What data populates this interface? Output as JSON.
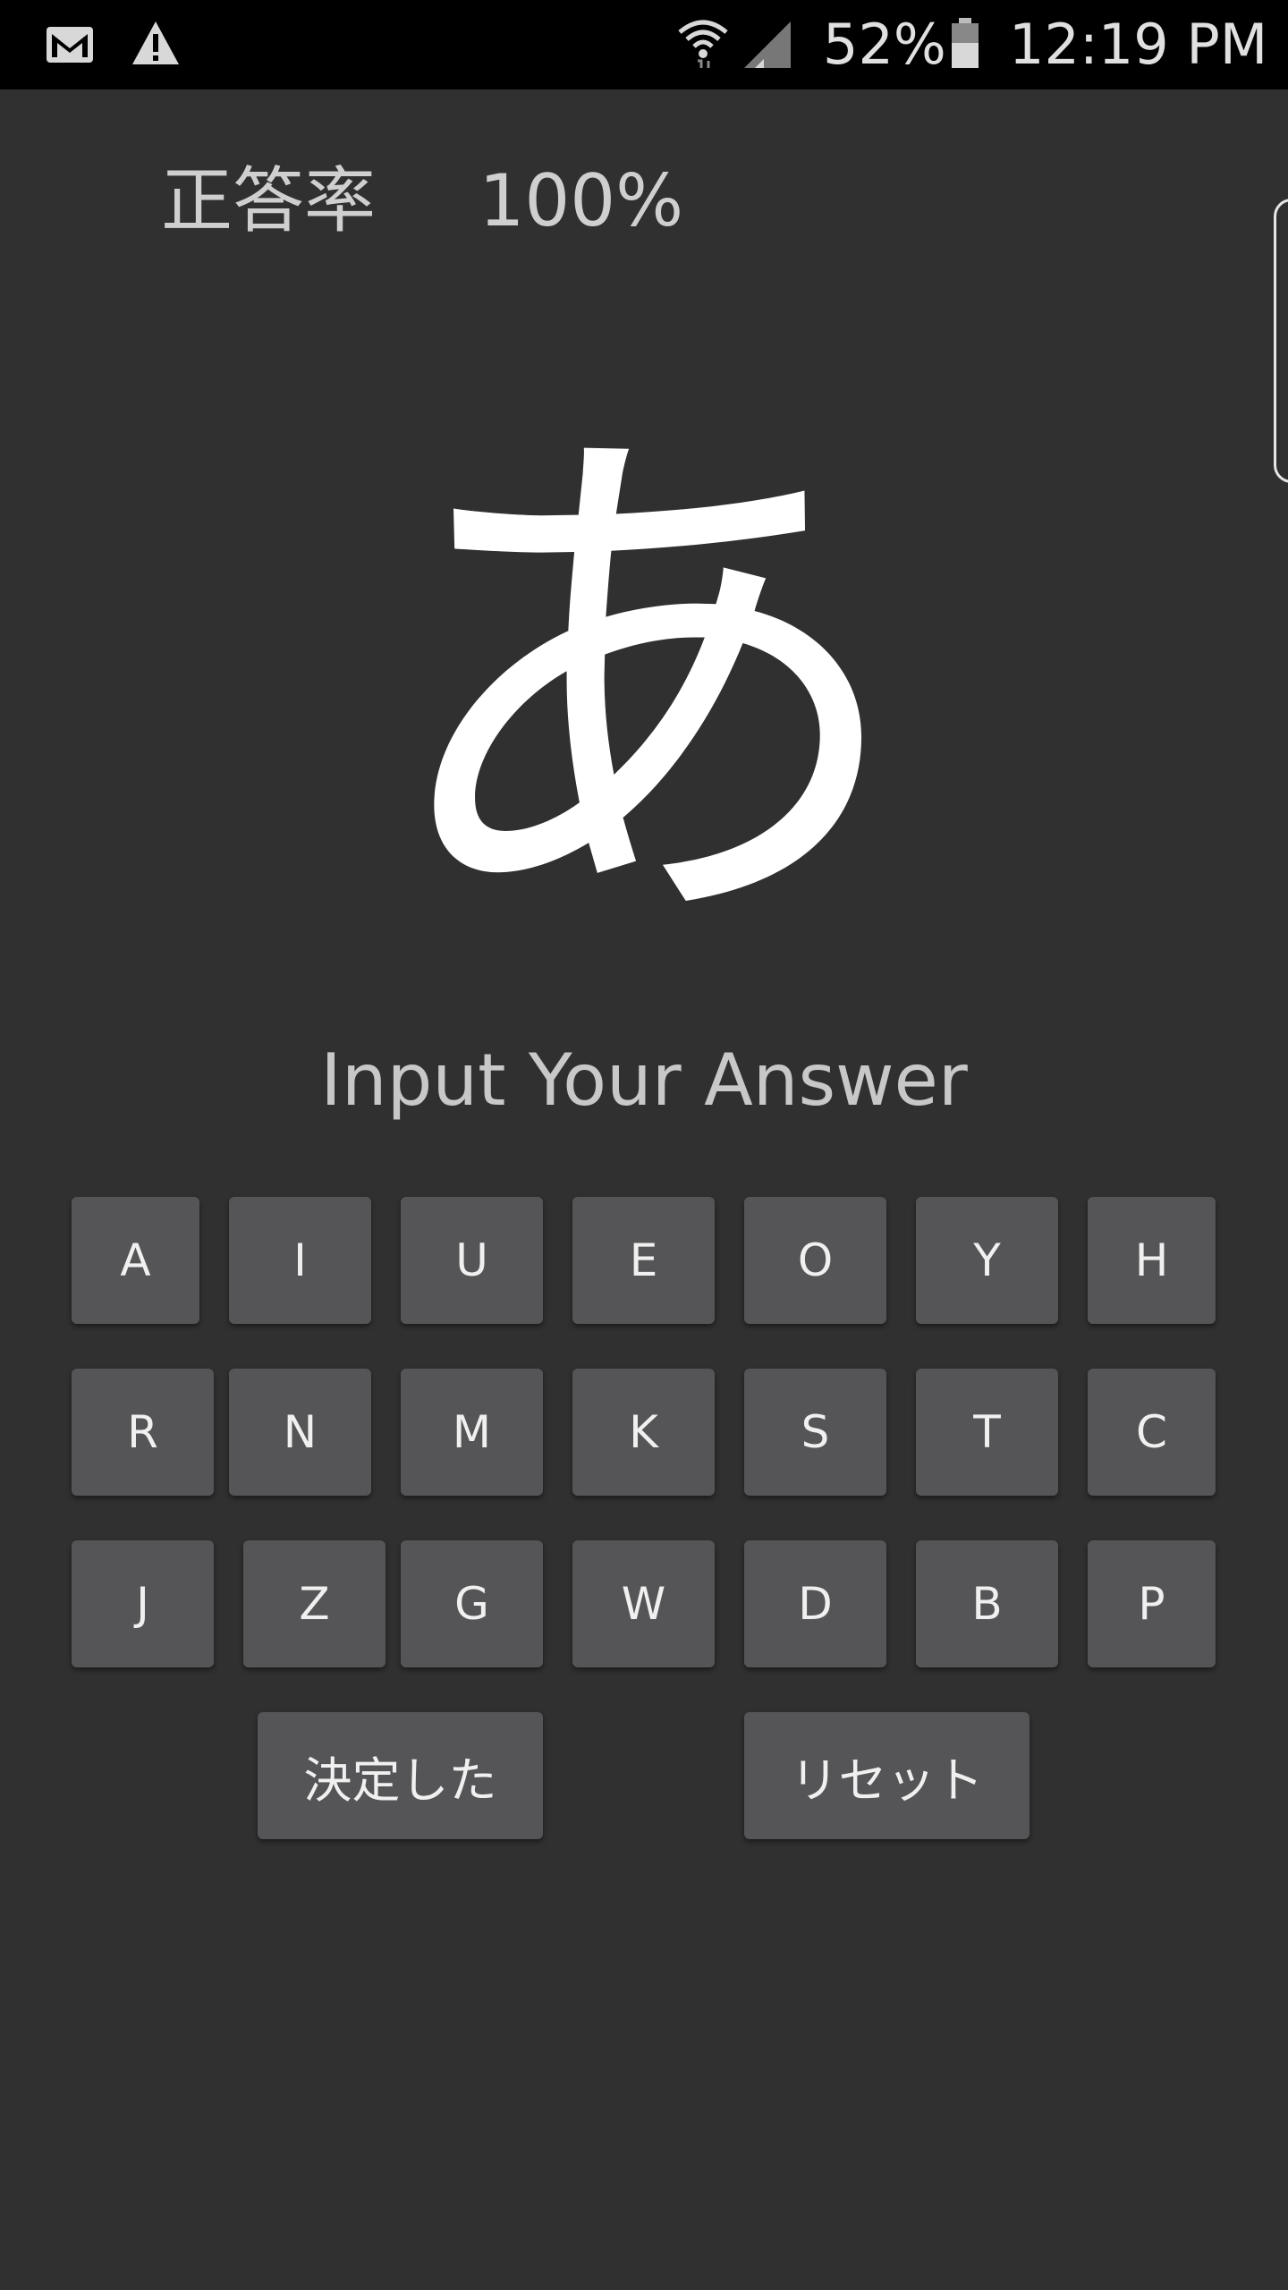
{
  "status_bar": {
    "icons": [
      "gmail-icon",
      "warning-icon",
      "wifi-icon",
      "signal-icon",
      "battery-icon"
    ],
    "battery": "52%",
    "time": "12:19 PM"
  },
  "score": {
    "label": "正答率",
    "value": "100%"
  },
  "question_char": "あ",
  "prompt": "Input Your Answer",
  "keys": {
    "row1": [
      "A",
      "I",
      "U",
      "E",
      "O",
      "Y",
      "H"
    ],
    "row2": [
      "R",
      "N",
      "M",
      "K",
      "S",
      "T",
      "C"
    ],
    "row3": [
      "J",
      "Z",
      "G",
      "W",
      "D",
      "B",
      "P"
    ]
  },
  "actions": {
    "submit": "決定した",
    "reset": "リセット"
  },
  "colors": {
    "background": "#303030",
    "key": "#555557",
    "status_bar": "#000000"
  }
}
